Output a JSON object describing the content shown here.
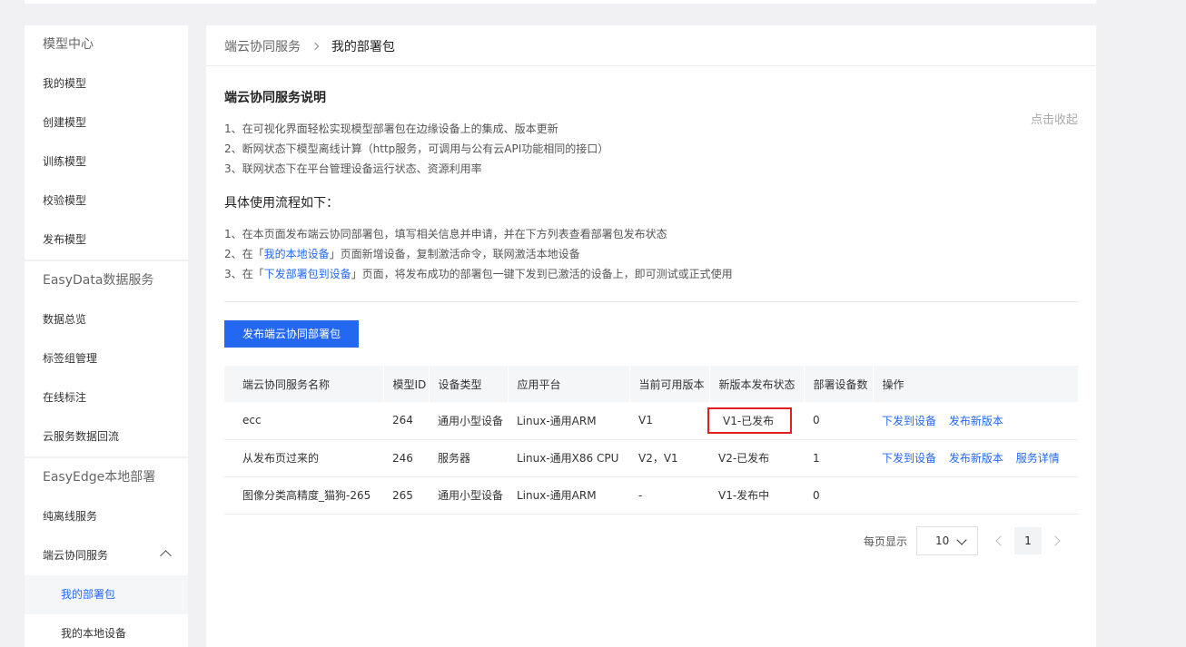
{
  "sidebar": {
    "groups": [
      {
        "title": "模型中心",
        "items": [
          "我的模型",
          "创建模型",
          "训练模型",
          "校验模型",
          "发布模型"
        ]
      },
      {
        "title": "EasyData数据服务",
        "items": [
          "数据总览",
          "标签组管理",
          "在线标注",
          "云服务数据回流"
        ]
      },
      {
        "title": "EasyEdge本地部署",
        "items": [
          "纯离线服务"
        ],
        "expanded_item": "端云协同服务",
        "sub_items": [
          "我的部署包",
          "我的本地设备"
        ]
      }
    ]
  },
  "breadcrumb": {
    "parent": "端云协同服务",
    "current": "我的部署包"
  },
  "intro": {
    "title": "端云协同服务说明",
    "collapse_label": "点击收起",
    "lines": [
      "1、在可视化界面轻松实现模型部署包在边缘设备上的集成、版本更新",
      "2、断网状态下模型离线计算（http服务，可调用与公有云API功能相同的接口）",
      "3、联网状态下在平台管理设备运行状态、资源利用率"
    ],
    "flow_title": "具体使用流程如下：",
    "flow": {
      "l1": "1、在本页面发布端云协同部署包，填写相关信息并申请，并在下方列表查看部署包发布状态",
      "l2_pre": "2、在「",
      "l2_link": "我的本地设备",
      "l2_post": "」页面新增设备，复制激活命令，联网激活本地设备",
      "l3_pre": "3、在「",
      "l3_link": "下发部署包到设备",
      "l3_post": "」页面，将发布成功的部署包一键下发到已激活的设备上，即可测试或正式使用"
    }
  },
  "publish_button": "发布端云协同部署包",
  "table": {
    "headers": [
      "端云协同服务名称",
      "模型ID",
      "设备类型",
      "应用平台",
      "当前可用版本",
      "新版本发布状态",
      "部署设备数",
      "操作"
    ],
    "rows": [
      {
        "name": "ecc",
        "model_id": "264",
        "device": "通用小型设备",
        "platform": "Linux-通用ARM",
        "version": "V1",
        "status": "V1-已发布",
        "count": "0",
        "actions": [
          "下发到设备",
          "发布新版本"
        ]
      },
      {
        "name": "从发布页过来的",
        "model_id": "246",
        "device": "服务器",
        "platform": "Linux-通用X86 CPU",
        "version": "V2，V1",
        "status": "V2-已发布",
        "count": "1",
        "actions": [
          "下发到设备",
          "发布新版本",
          "服务详情"
        ]
      },
      {
        "name": "图像分类高精度_猫狗-265",
        "model_id": "265",
        "device": "通用小型设备",
        "platform": "Linux-通用ARM",
        "version": "-",
        "status": "V1-发布中",
        "count": "0",
        "actions": []
      }
    ]
  },
  "pagination": {
    "per_page_label": "每页显示",
    "page_size": "10",
    "current_page": "1"
  },
  "colors": {
    "accent": "#2468f2",
    "highlight_border": "#e02020"
  }
}
